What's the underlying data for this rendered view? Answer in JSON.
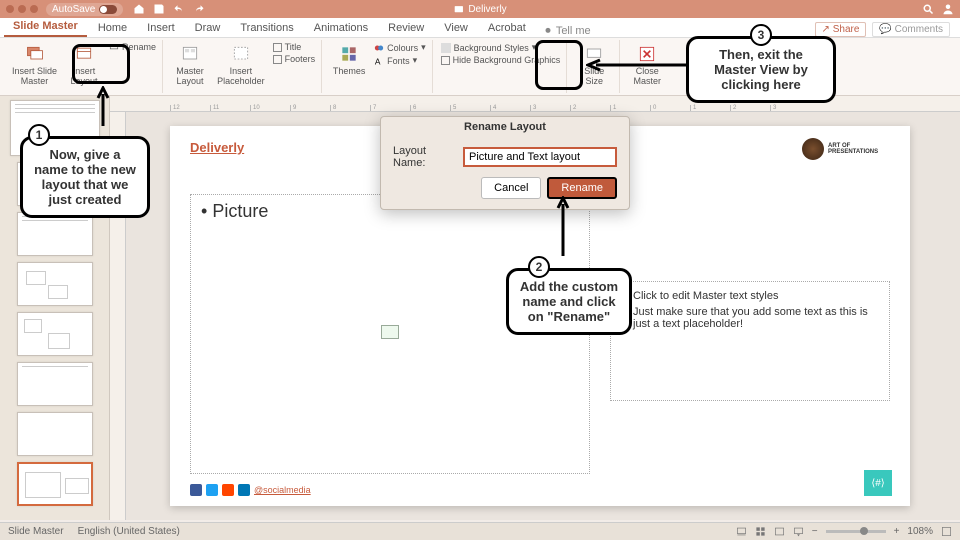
{
  "titlebar": {
    "autosave": "AutoSave",
    "doc": "Deliverly"
  },
  "tabs": {
    "items": [
      "Slide Master",
      "Home",
      "Insert",
      "Draw",
      "Transitions",
      "Animations",
      "Review",
      "View",
      "Acrobat"
    ],
    "tellme": "Tell me",
    "share": "Share",
    "comments": "Comments"
  },
  "ribbon": {
    "insert_slide_master": "Insert Slide\nMaster",
    "insert_layout": "Insert\nLayout",
    "rename": "Rename",
    "master_layout": "Master\nLayout",
    "insert_placeholder": "Insert\nPlaceholder",
    "title": "Title",
    "footers": "Footers",
    "themes": "Themes",
    "colours": "Colours",
    "fonts": "Fonts",
    "bg_styles": "Background Styles",
    "hide_bg": "Hide Background Graphics",
    "slide_size": "Slide\nSize",
    "close_master": "Close\nMaster"
  },
  "slide": {
    "brand": "Deliverly",
    "logo_text": "ART OF\nPRESENTATIONS",
    "picture_label": "Picture",
    "text_ph_1": "Click to edit Master text styles",
    "text_ph_2": "Just make sure that you add some text as this is just a text placeholder!",
    "social": "@socialmedia"
  },
  "dialog": {
    "title": "Rename Layout",
    "label": "Layout Name:",
    "value": "Picture and Text layout",
    "cancel": "Cancel",
    "rename": "Rename"
  },
  "callouts": {
    "c1": "Now, give a name to the new layout that we just created",
    "c2": "Add the custom name and click on \"Rename\"",
    "c3": "Then, exit the Master View by clicking here"
  },
  "status": {
    "mode": "Slide Master",
    "lang": "English (United States)",
    "zoom": "108%"
  }
}
